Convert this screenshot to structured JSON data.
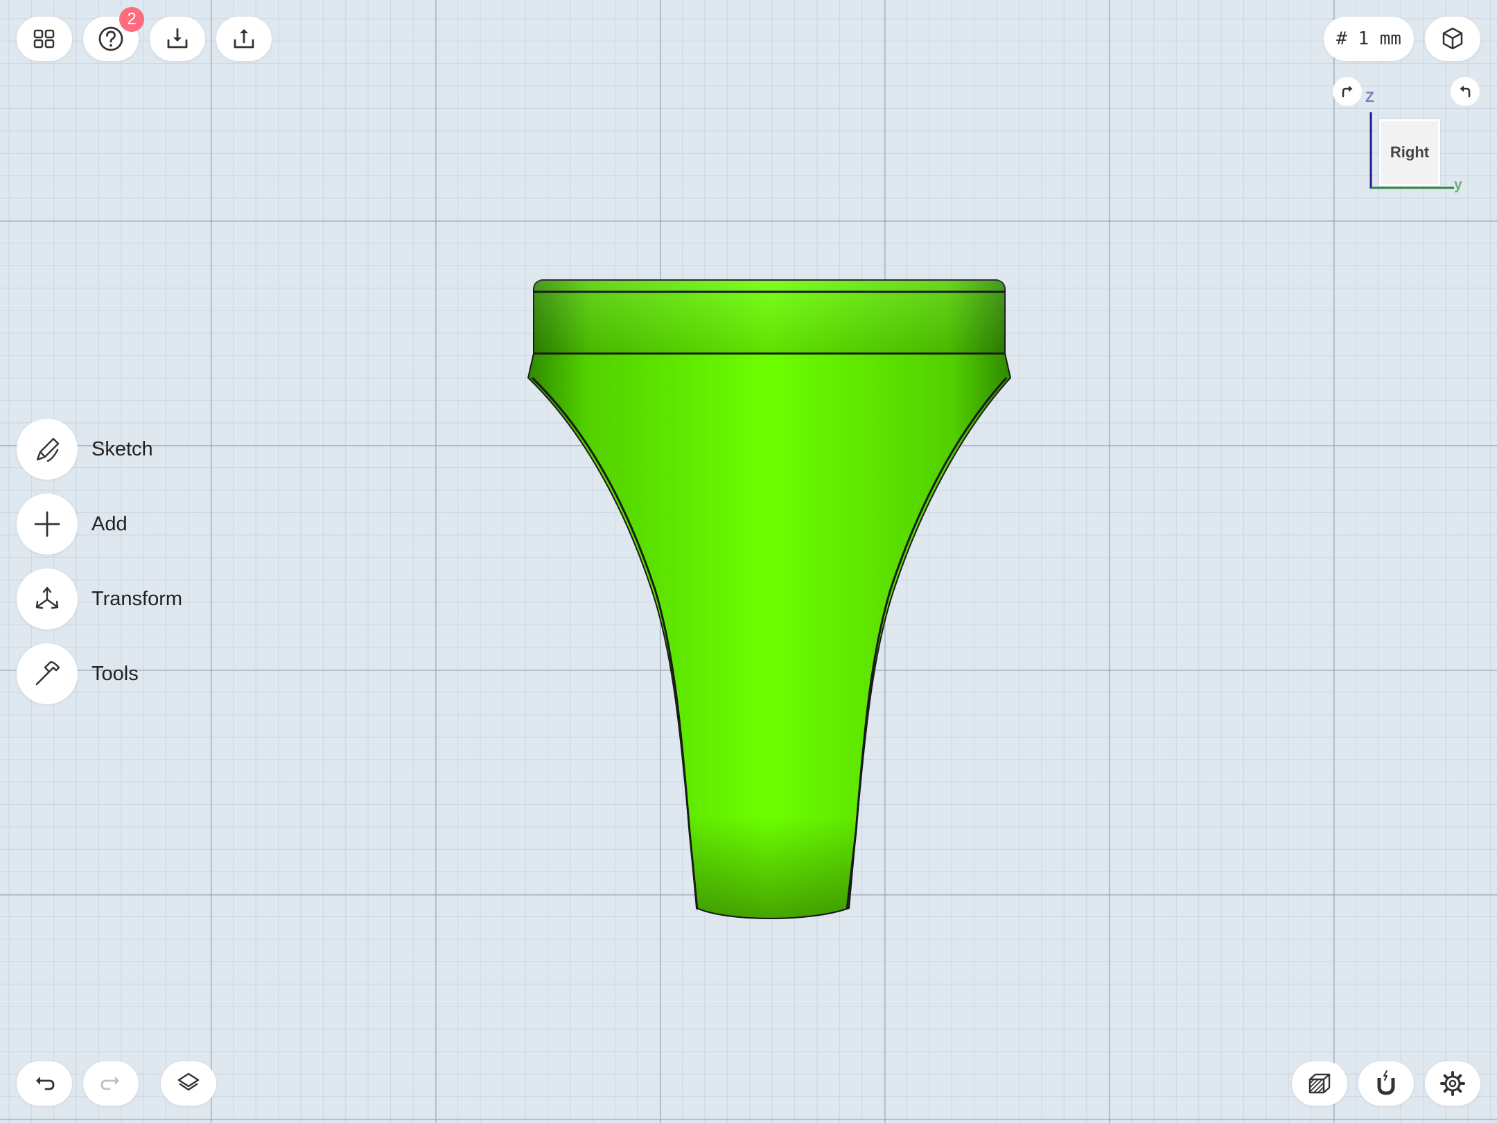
{
  "toolbar": {
    "help_badge_count": "2"
  },
  "units": {
    "grid_label": "# 1 mm"
  },
  "side_menu": {
    "items": [
      {
        "label": "Sketch",
        "icon": "pencil-sketch-icon"
      },
      {
        "label": "Add",
        "icon": "plus-icon"
      },
      {
        "label": "Transform",
        "icon": "transform-arrows-icon"
      },
      {
        "label": "Tools",
        "icon": "hammer-icon"
      }
    ]
  },
  "view_cube": {
    "face_label": "Right",
    "axis_z": "Z",
    "axis_y": "y",
    "colors": {
      "z_axis": "#1c1c8c",
      "y_axis": "#2e8b3e",
      "z_label": "#7a7fb5",
      "y_label": "#6fae7a"
    }
  },
  "model": {
    "color": "#6cff00",
    "outline": "#1a1a1a"
  },
  "colors": {
    "background": "#dfe7ef",
    "badge": "#ff6b7d"
  }
}
